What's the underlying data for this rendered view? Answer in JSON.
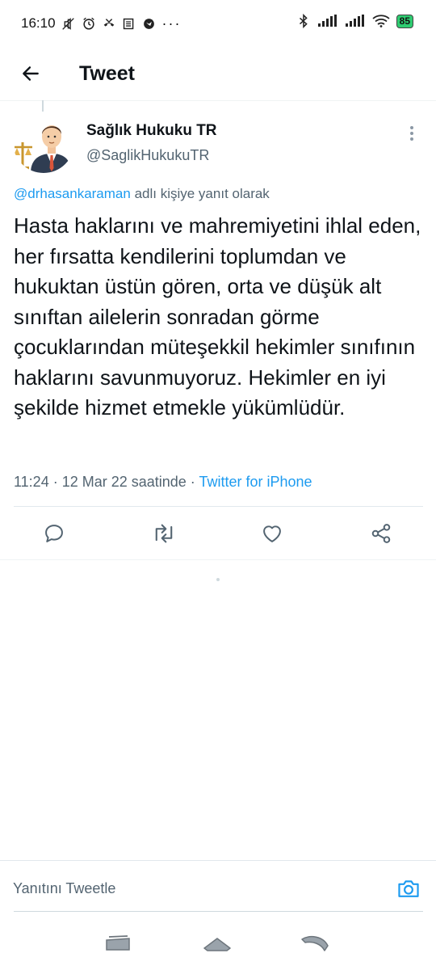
{
  "status_bar": {
    "time": "16:10",
    "battery": "85"
  },
  "header": {
    "title": "Tweet"
  },
  "tweet": {
    "author_name": "Sağlık Hukuku TR",
    "author_handle": "@SaglikHukukuTR",
    "reply_to_handle": "@drhasankaraman",
    "reply_to_suffix": " adlı kişiye yanıt olarak",
    "text": "Hasta haklarını ve mahremiyetini ihlal eden, her fırsatta kendilerini toplumdan ve hukuktan üstün gören, orta ve düşük alt sınıftan ailelerin sonradan görme çocuklarından müteşekkil hekimler sınıfının haklarını savunmuyoruz. Hekimler en iyi şekilde hizmet etmekle yükümlüdür.",
    "timestamp": "11:24 · 12 Mar 22 saatinde · ",
    "source": "Twitter for iPhone"
  },
  "actions": [
    {
      "name": "reply-icon"
    },
    {
      "name": "retweet-icon"
    },
    {
      "name": "like-icon"
    },
    {
      "name": "share-icon"
    }
  ],
  "reply": {
    "placeholder": "Yanıtını Tweetle"
  },
  "colors": {
    "accent": "#1d9bf0",
    "text": "#0f1419",
    "secondary": "#536471"
  }
}
